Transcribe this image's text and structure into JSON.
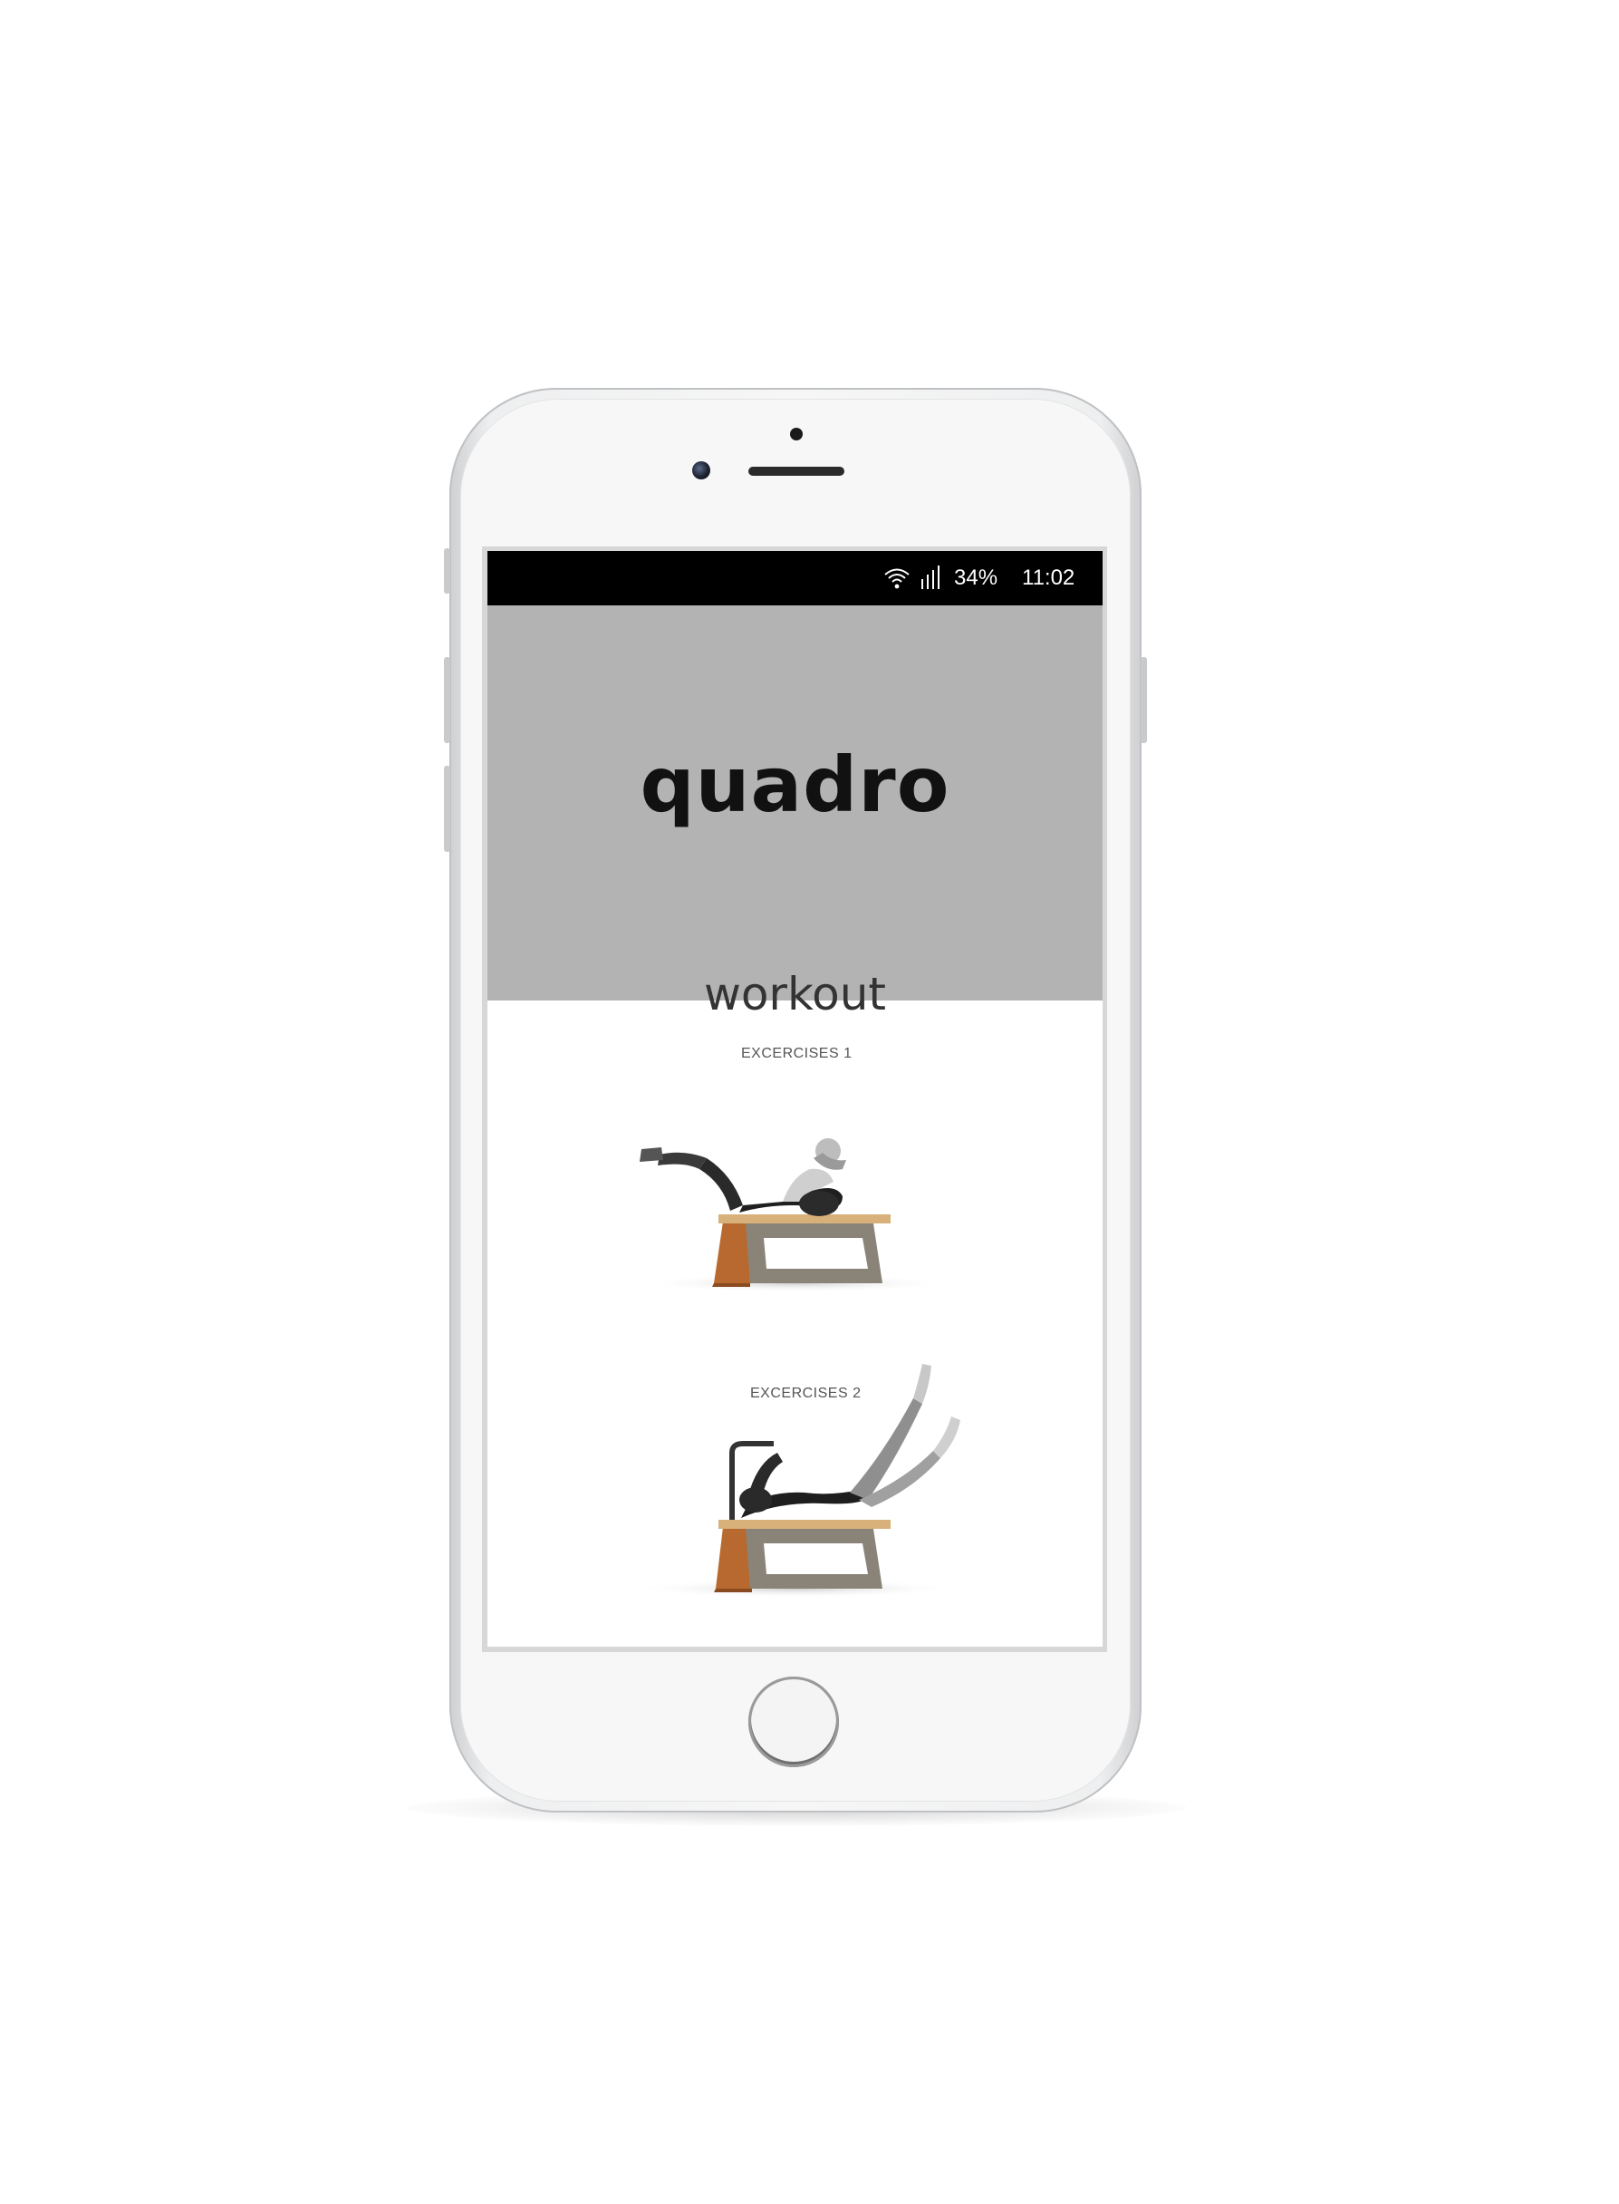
{
  "status_bar": {
    "wifi_icon": "wifi-icon",
    "signal_icon": "signal-bars-icon",
    "battery": "34%",
    "time": "11:02"
  },
  "hero": {
    "title": "quadro",
    "background": "#b3b3b3"
  },
  "workout": {
    "title": "workout",
    "exercises": [
      {
        "label": "EXCERCISES 1",
        "image": "crunch-on-bench-illustration"
      },
      {
        "label": "EXCERCISES 2",
        "image": "leg-raise-on-bench-illustration"
      }
    ]
  },
  "device": {
    "home_button_icon": "home-button-icon",
    "camera_icon": "front-camera-icon",
    "speaker_icon": "earpiece-speaker-icon"
  },
  "colors": {
    "status_bar": "#000000",
    "hero_bg": "#b3b3b3",
    "bench_wood": "#b8692f",
    "bench_frame": "#8a8478"
  }
}
